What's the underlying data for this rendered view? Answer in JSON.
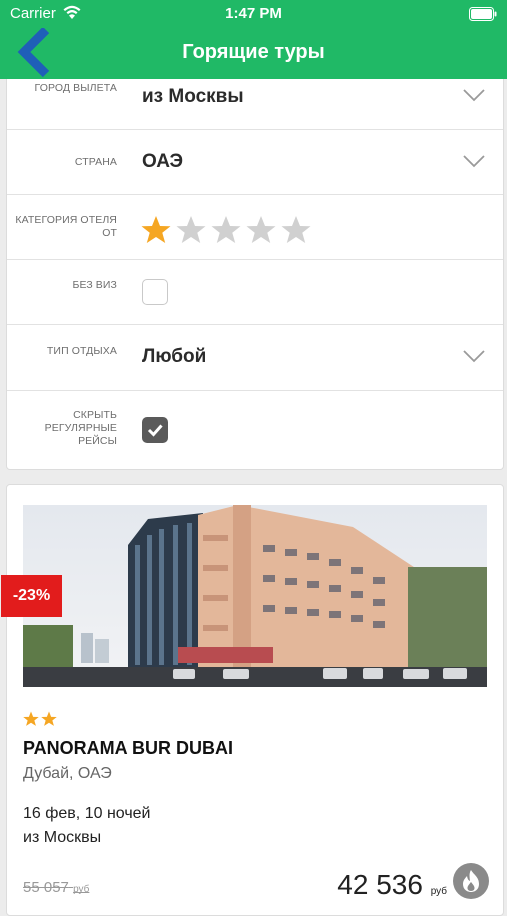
{
  "status_bar": {
    "carrier": "Carrier",
    "time": "1:47 PM"
  },
  "nav": {
    "title": "Горящие туры",
    "back_icon": "chevron-left-icon"
  },
  "filters": {
    "departure": {
      "label": "Город вылета",
      "value": "из Москвы"
    },
    "country": {
      "label": "Страна",
      "value": "ОАЭ"
    },
    "hotel_category": {
      "label": "Категория отеля от",
      "selected_stars": 1,
      "max_stars": 5
    },
    "no_visa": {
      "label": "Без виз",
      "checked": false
    },
    "rest_type": {
      "label": "Тип отдыха",
      "value": "Любой"
    },
    "hide_regular": {
      "label": "Скрыть регулярные рейсы",
      "checked": true
    }
  },
  "hotel": {
    "discount": "-23%",
    "stars": 2,
    "name": "PANORAMA BUR DUBAI",
    "location": "Дубай, ОАЭ",
    "dates": "16 фев, 10 ночей",
    "departure": "из Москвы",
    "old_price": "55 057",
    "new_price": "42 536",
    "currency": "руб",
    "hot_icon": "fire-icon"
  },
  "colors": {
    "brand_green": "#20b966",
    "star_active": "#f5a623",
    "star_inactive": "#d0d0d0",
    "discount_red": "#e21c1c"
  }
}
